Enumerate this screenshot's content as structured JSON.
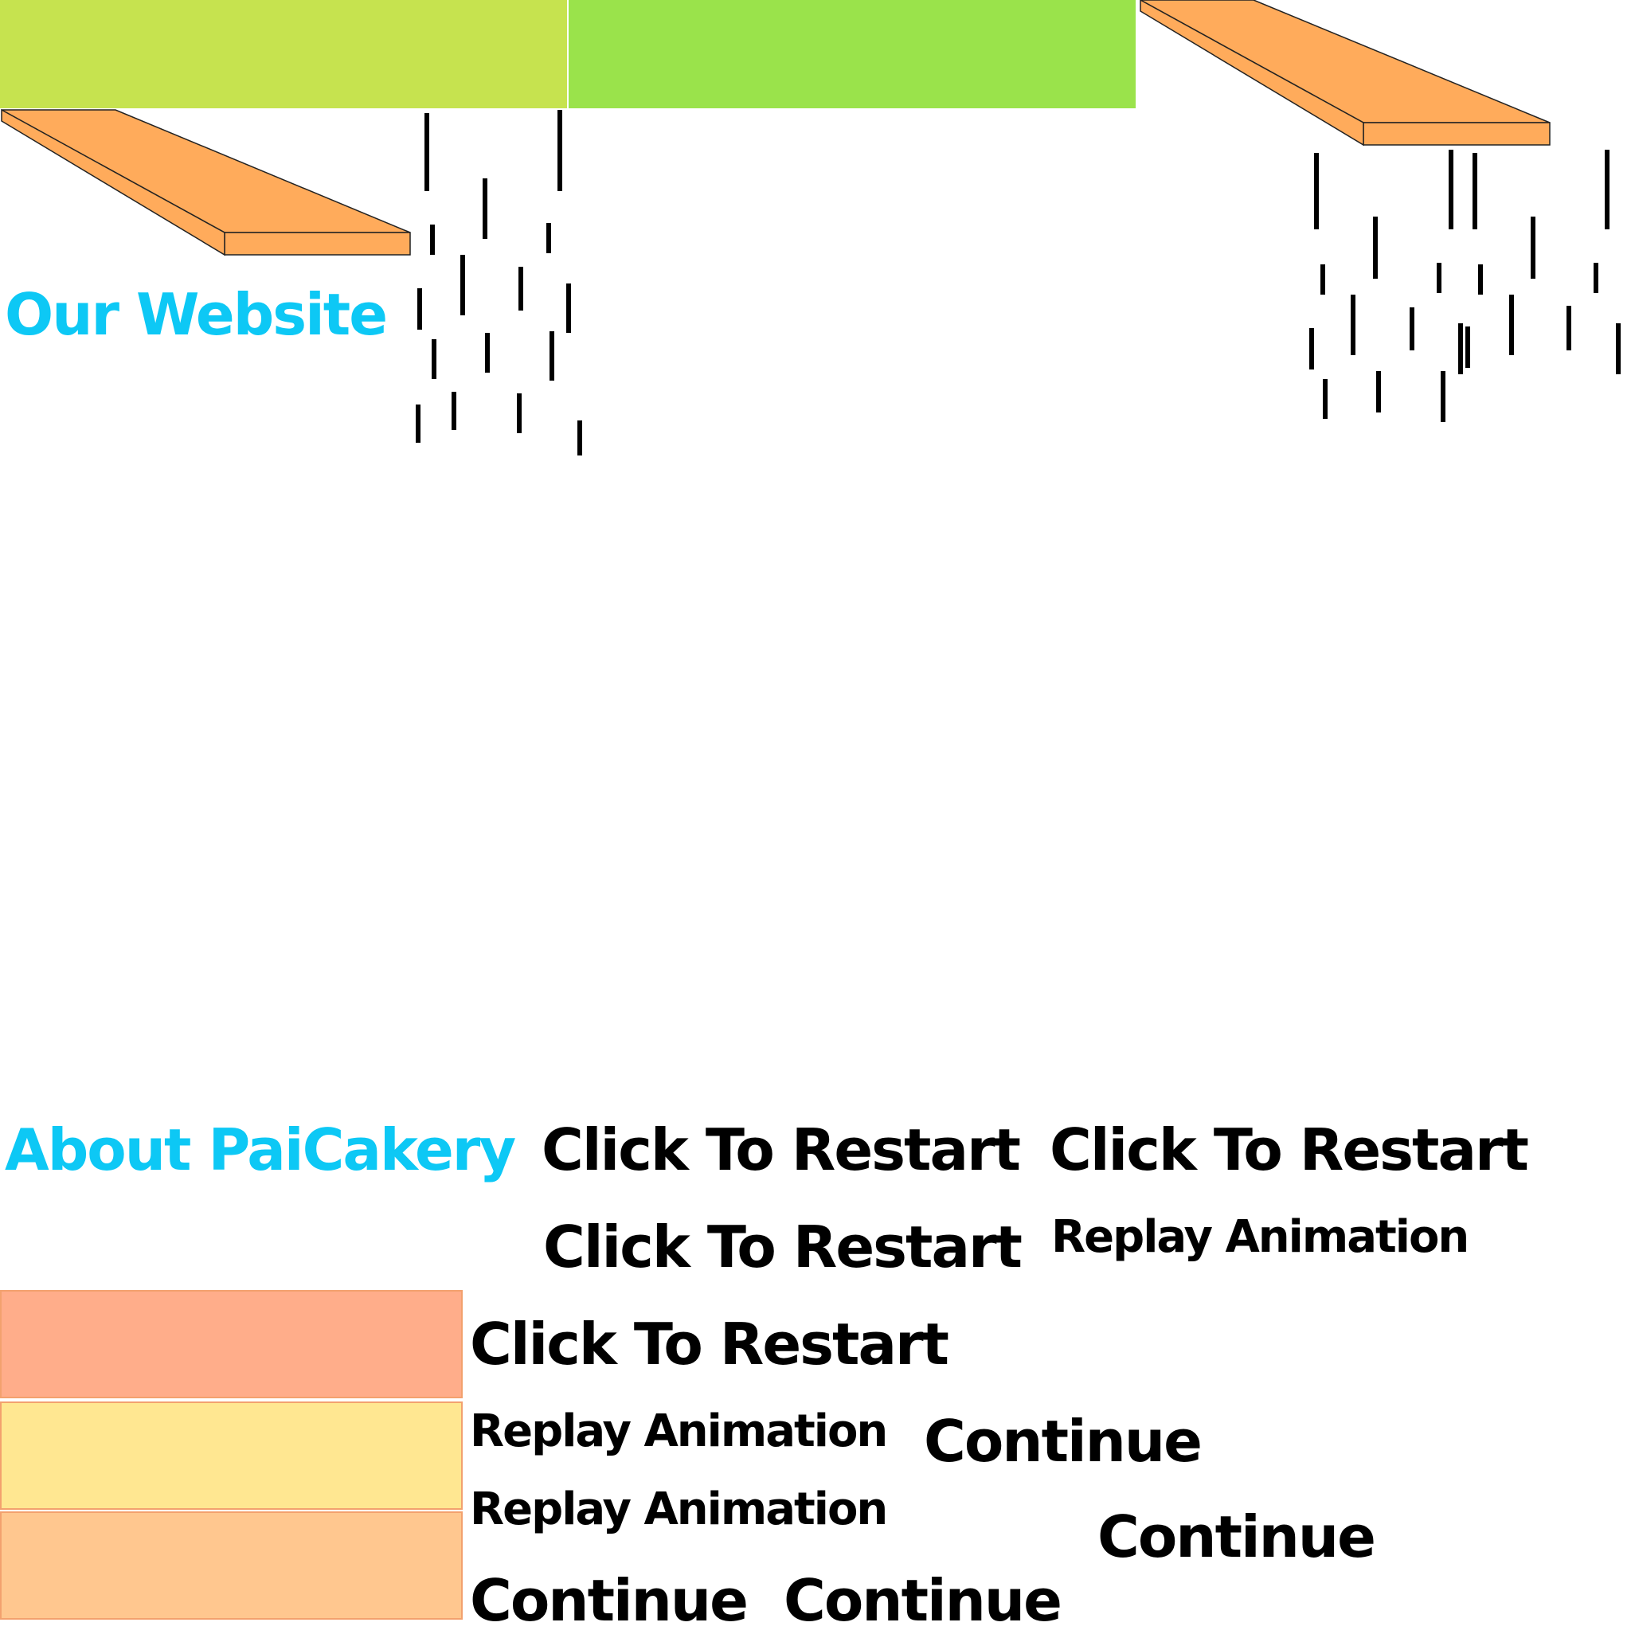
{
  "colors": {
    "band_left": "#c6e34f",
    "band_right": "#9ae34b",
    "plank_fill": "#ffab5b",
    "heading": "#0dc8f5",
    "swatch_1": "#ffad8a",
    "swatch_2": "#ffe791",
    "swatch_3": "#ffc78f"
  },
  "headings": {
    "our_website": "Our Website",
    "about": "About PaiCakery"
  },
  "actions": {
    "restart_1": "Click To Restart",
    "restart_2": "Click To Restart",
    "restart_3": "Click To Restart",
    "restart_4": "Click To Restart",
    "replay_1": "Replay Animation",
    "replay_2": "Replay Animation",
    "replay_3": "Replay Animation",
    "continue_1": "Continue",
    "continue_2": "Continue",
    "continue_3": "Continue",
    "continue_4": "Continue"
  }
}
